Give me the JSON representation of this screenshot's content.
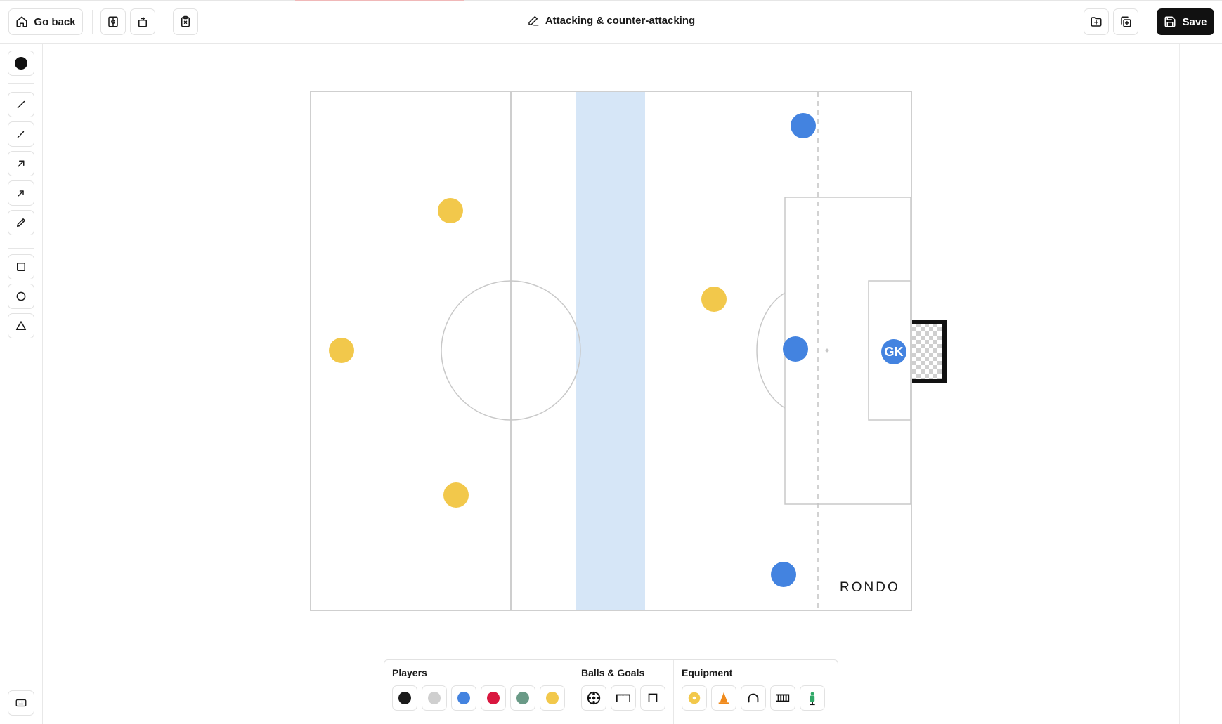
{
  "header": {
    "go_back_label": "Go back",
    "title": "Attacking & counter-attacking",
    "save_label": "Save"
  },
  "pitch": {
    "watermark": "RONDO",
    "players": [
      {
        "team": "yellow",
        "color": "#F2C84B"
      },
      {
        "team": "yellow",
        "color": "#F2C84B"
      },
      {
        "team": "yellow",
        "color": "#F2C84B"
      },
      {
        "team": "yellow",
        "color": "#F2C84B"
      },
      {
        "team": "blue",
        "color": "#4383E0"
      },
      {
        "team": "blue",
        "color": "#4383E0"
      },
      {
        "team": "blue",
        "color": "#4383E0"
      }
    ],
    "goalkeeper": {
      "label": "GK",
      "color": "#4383E0"
    },
    "zone_color": "#D6E6F7"
  },
  "palette": {
    "players_title": "Players",
    "balls_goals_title": "Balls & Goals",
    "equipment_title": "Equipment",
    "player_colors": [
      "#1B1B1B",
      "#CFCFCF",
      "#4383E0",
      "#D9173F",
      "#6A9A87",
      "#F2C84B"
    ],
    "balls_goals": [
      "soccer-ball",
      "large-goal",
      "small-goal"
    ],
    "equipment": [
      "marker-disc",
      "cone",
      "hurdle",
      "ladder",
      "mannequin"
    ]
  },
  "colors": {
    "accent_dark": "#111111",
    "border": "#E2E2E2"
  }
}
